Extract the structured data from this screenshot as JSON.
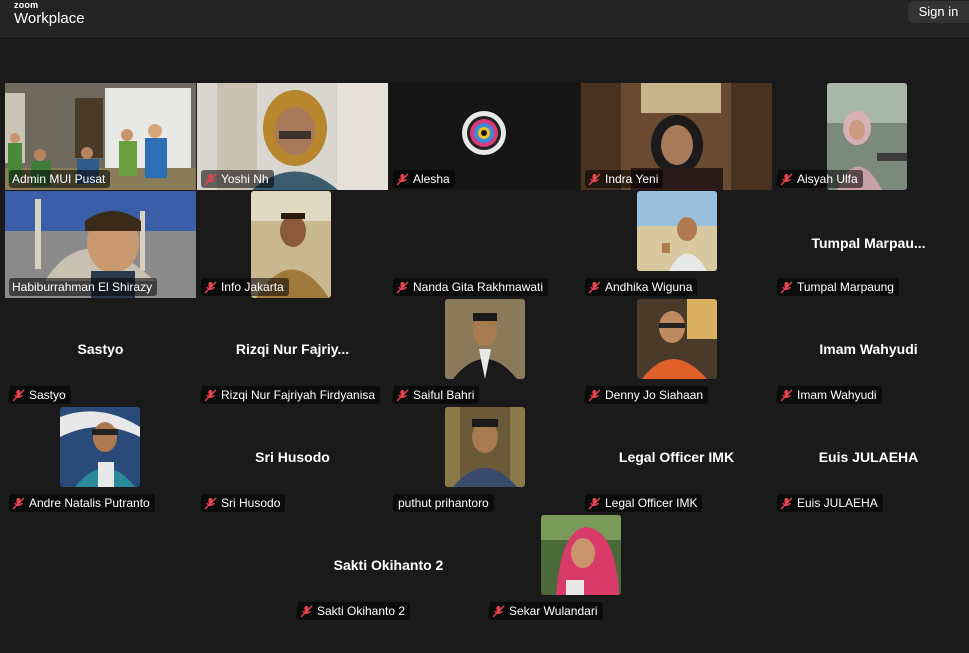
{
  "app": {
    "brand_top": "zoom",
    "brand_bottom": "Workplace",
    "signin_label": "Sign in"
  },
  "participants": {
    "p0": {
      "label": "Admin MUI Pusat",
      "center": ""
    },
    "p1": {
      "label": "Yoshi Nh",
      "center": ""
    },
    "p2": {
      "label": "Alesha",
      "center": ""
    },
    "p3": {
      "label": "Indra Yeni",
      "center": ""
    },
    "p4": {
      "label": "Aisyah Ulfa",
      "center": ""
    },
    "p5": {
      "label": "Habiburrahman El Shirazy",
      "center": ""
    },
    "p6": {
      "label": "Info Jakarta",
      "center": ""
    },
    "p7": {
      "label": "Nanda Gita Rakhmawati",
      "center": ""
    },
    "p8": {
      "label": "Andhika Wiguna",
      "center": ""
    },
    "p9": {
      "label": "Tumpal Marpaung",
      "center": "Tumpal  Marpau..."
    },
    "p10": {
      "label": "Sastyo",
      "center": "Sastyo"
    },
    "p11": {
      "label": "Rizqi Nur Fajriyah Firdyanisa",
      "center": "Rizqi  Nur  Fajriy..."
    },
    "p12": {
      "label": "Saiful Bahri",
      "center": ""
    },
    "p13": {
      "label": "Denny Jo Siahaan",
      "center": ""
    },
    "p14": {
      "label": "Imam Wahyudi",
      "center": "Imam Wahyudi"
    },
    "p15": {
      "label": "Andre Natalis Putranto",
      "center": ""
    },
    "p16": {
      "label": "Sri Husodo",
      "center": "Sri Husodo"
    },
    "p17": {
      "label": "puthut prihantoro",
      "center": ""
    },
    "p18": {
      "label": "Legal Officer IMK",
      "center": "Legal Officer IMK"
    },
    "p19": {
      "label": "Euis JULAEHA",
      "center": "Euis JULAEHA"
    },
    "p20": {
      "label": "Sakti Okihanto 2",
      "center": "Sakti Okihanto 2"
    },
    "p21": {
      "label": "Sekar Wulandari",
      "center": ""
    }
  },
  "colors": {
    "active_speaker_border": "#2ccf7d",
    "muted_icon": "#e0464e"
  }
}
